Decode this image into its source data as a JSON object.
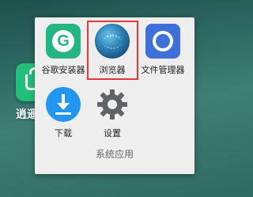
{
  "background": {
    "app_label": "逍遥市"
  },
  "folder": {
    "name": "系统应用",
    "apps": [
      {
        "label": "谷歌安装器"
      },
      {
        "label": "浏览器"
      },
      {
        "label": "文件管理器"
      },
      {
        "label": "下载"
      },
      {
        "label": "设置"
      }
    ]
  },
  "colors": {
    "highlight": "#e53935",
    "store": "#23b683",
    "files": "#3f6fd8",
    "download": "#2196f3"
  }
}
